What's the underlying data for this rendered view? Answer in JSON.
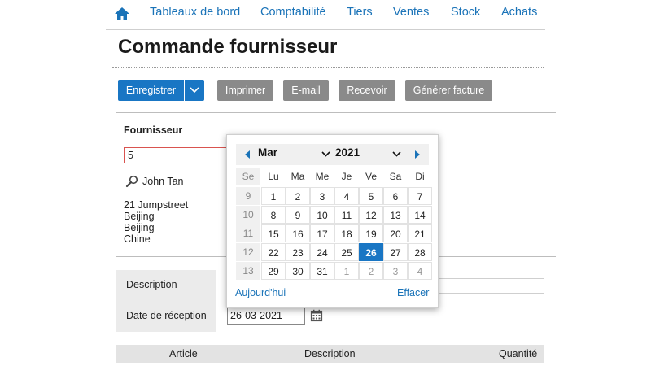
{
  "nav": {
    "items": [
      "Tableaux de bord",
      "Comptabilité",
      "Tiers",
      "Ventes",
      "Stock",
      "Achats"
    ]
  },
  "page": {
    "title": "Commande fournisseur"
  },
  "toolbar": {
    "save_label": "Enregistrer",
    "print_label": "Imprimer",
    "email_label": "E-mail",
    "receive_label": "Recevoir",
    "invoice_label": "Générer facture"
  },
  "supplier": {
    "label": "Fournisseur",
    "value": "5",
    "contact_name": "John Tan",
    "address": [
      "21 Jumpstreet",
      "Beijing",
      "Beijing",
      "Chine"
    ]
  },
  "form": {
    "description_label": "Description",
    "reception_date_label": "Date de réception",
    "reception_date_value": "26-03-2021"
  },
  "table": {
    "headers": [
      "Article",
      "Description",
      "Quantité"
    ]
  },
  "datepicker": {
    "month": "Mar",
    "year": "2021",
    "week_header": "Se",
    "weekdays": [
      "Lu",
      "Ma",
      "Me",
      "Je",
      "Ve",
      "Sa",
      "Di"
    ],
    "weeks": [
      {
        "week": "9",
        "days": [
          "1",
          "2",
          "3",
          "4",
          "5",
          "6",
          "7"
        ]
      },
      {
        "week": "10",
        "days": [
          "8",
          "9",
          "10",
          "11",
          "12",
          "13",
          "14"
        ]
      },
      {
        "week": "11",
        "days": [
          "15",
          "16",
          "17",
          "18",
          "19",
          "20",
          "21"
        ]
      },
      {
        "week": "12",
        "days": [
          "22",
          "23",
          "24",
          "25",
          "26",
          "27",
          "28"
        ]
      },
      {
        "week": "13",
        "days": [
          "29",
          "30",
          "31",
          "1",
          "2",
          "3",
          "4"
        ]
      }
    ],
    "selected_day": "26",
    "today_label": "Aujourd'hui",
    "clear_label": "Effacer"
  },
  "colors": {
    "accent": "#1976c4",
    "link": "#1a73b8",
    "button_grey": "#8a8a8a"
  }
}
